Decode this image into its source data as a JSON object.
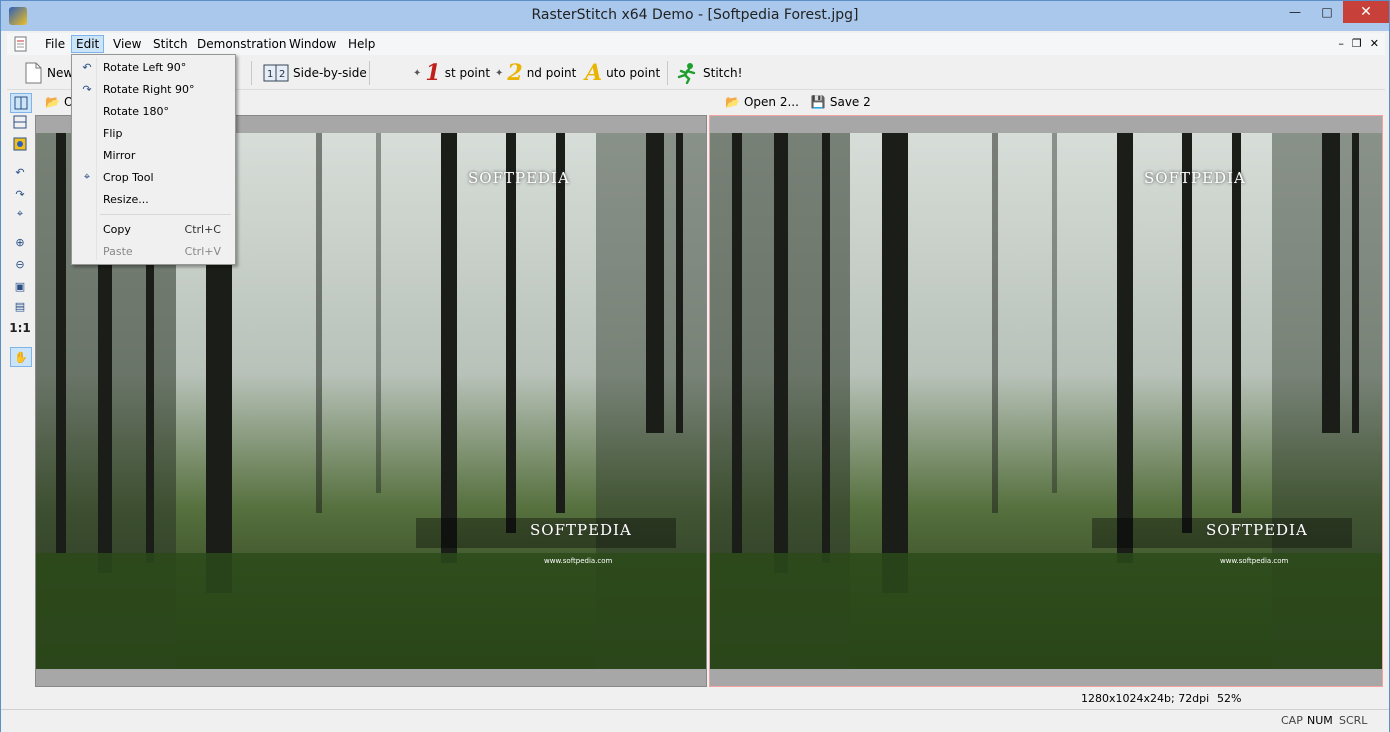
{
  "window": {
    "title": "RasterStitch x64 Demo - [Softpedia Forest.jpg]"
  },
  "menu": {
    "file": "File",
    "edit": "Edit",
    "view": "View",
    "stitch": "Stitch",
    "demonstration": "Demonstration",
    "window": "Window",
    "help": "Help"
  },
  "toolbar": {
    "new": "New",
    "side_by_side": "Side-by-side",
    "first_num": "1",
    "first_point": "st point",
    "second_num": "2",
    "second_point": "nd point",
    "auto_letter": "A",
    "auto_point": "uto point",
    "stitch": "Stitch!"
  },
  "pane_bar": {
    "open1": "O",
    "open2": "Open 2...",
    "save2": "Save 2"
  },
  "edit_menu": {
    "rotate_left": "Rotate Left 90°",
    "rotate_right": "Rotate Right 90°",
    "rotate_180": "Rotate 180°",
    "flip": "Flip",
    "mirror": "Mirror",
    "crop_tool": "Crop Tool",
    "resize": "Resize...",
    "copy": "Copy",
    "copy_shortcut": "Ctrl+C",
    "paste": "Paste",
    "paste_shortcut": "Ctrl+V"
  },
  "side_tools": {
    "actual_size": "1:1"
  },
  "image": {
    "watermark_top": "SOFTPEDIA",
    "watermark_bottom": "SOFTPEDIA",
    "watermark_url": "www.softpedia.com",
    "reg": "®"
  },
  "status": {
    "image_info": "1280x1024x24b; 72dpi",
    "zoom": "52%",
    "cap": "CAP",
    "num": "NUM",
    "scrl": "SCRL"
  }
}
